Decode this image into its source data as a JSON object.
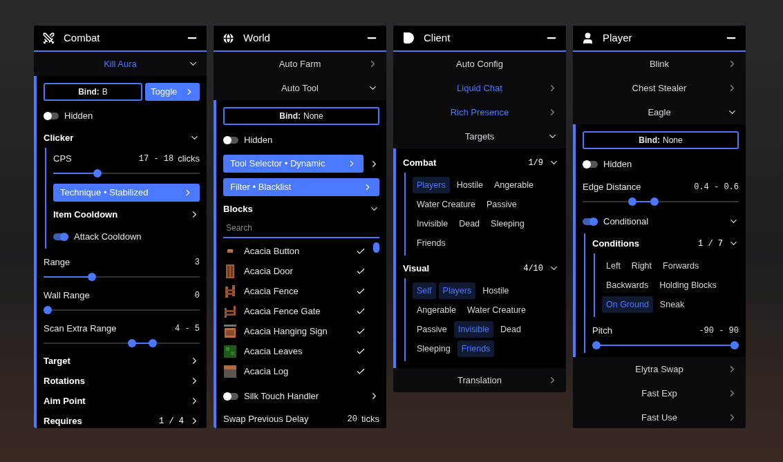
{
  "panels": [
    {
      "title": "Combat",
      "items": [
        {
          "kind": "module",
          "name": "Kill Aura",
          "enabled": true,
          "has_settings": true,
          "expanded": true,
          "children": [
            {
              "kind": "bind",
              "label": "Bind:",
              "value": "B",
              "mode": "Toggle"
            },
            {
              "kind": "toggle",
              "label": "Hidden",
              "on": false
            },
            {
              "kind": "group",
              "label": "Clicker",
              "expanded": true,
              "children": [
                {
                  "kind": "slider",
                  "label": "CPS",
                  "value": "17 - 18",
                  "unit": "clicks",
                  "thumbs": [
                    {
                      "level": 0.29
                    }
                  ]
                },
                {
                  "kind": "choice",
                  "label": "Technique • Stabilized",
                  "outer_arrow": false
                },
                {
                  "kind": "group",
                  "label": "Item Cooldown",
                  "expanded": false
                },
                {
                  "kind": "toggle",
                  "label": "Attack Cooldown",
                  "on": true
                }
              ]
            },
            {
              "kind": "slider",
              "label": "Range",
              "value": "3",
              "thumbs": [
                {
                  "level": 0.3
                }
              ]
            },
            {
              "kind": "slider",
              "label": "Wall Range",
              "value": "0",
              "thumbs": [
                {
                  "level": 0
                }
              ]
            },
            {
              "kind": "slider",
              "label": "Scan Extra Range",
              "value": "4 - 5",
              "thumbs": [
                {
                  "level": 0.57
                },
                {
                  "level": 0.71
                }
              ]
            },
            {
              "kind": "group",
              "label": "Target",
              "expanded": false
            },
            {
              "kind": "group",
              "label": "Rotations",
              "expanded": false
            },
            {
              "kind": "group",
              "label": "Aim Point",
              "expanded": false
            },
            {
              "kind": "group",
              "label": "Requires",
              "count": "1 / 4",
              "expanded": false
            }
          ]
        }
      ]
    },
    {
      "title": "World",
      "items": [
        {
          "kind": "module",
          "name": "Auto Farm",
          "enabled": false,
          "has_settings": true,
          "expanded": false
        },
        {
          "kind": "module",
          "name": "Auto Tool",
          "enabled": false,
          "has_settings": true,
          "expanded": true,
          "children": [
            {
              "kind": "bind",
              "label": "Bind:",
              "value": "None"
            },
            {
              "kind": "toggle",
              "label": "Hidden",
              "on": false
            },
            {
              "kind": "choice",
              "label": "Tool Selector • Dynamic",
              "outer_arrow": true
            },
            {
              "kind": "choice",
              "label": "Filter • Blacklist",
              "outer_arrow": false
            },
            {
              "kind": "group",
              "label": "Blocks",
              "expanded": true,
              "children": [
                {
                  "kind": "search",
                  "placeholder": "Search"
                },
                {
                  "kind": "blocks",
                  "items": [
                    {
                      "name": "Acacia Button",
                      "checked": true
                    },
                    {
                      "name": "Acacia Door",
                      "checked": true
                    },
                    {
                      "name": "Acacia Fence",
                      "checked": true
                    },
                    {
                      "name": "Acacia Fence Gate",
                      "checked": true
                    },
                    {
                      "name": "Acacia Hanging Sign",
                      "checked": true
                    },
                    {
                      "name": "Acacia Leaves",
                      "checked": true
                    },
                    {
                      "name": "Acacia Log",
                      "checked": true
                    }
                  ]
                }
              ]
            },
            {
              "kind": "toggle",
              "label": "Silk Touch Handler",
              "on": false,
              "expanded": false
            },
            {
              "kind": "slider",
              "label": "Swap Previous Delay",
              "value": "20",
              "unit": "ticks"
            }
          ]
        }
      ]
    },
    {
      "title": "Client",
      "items": [
        {
          "kind": "module",
          "name": "Auto Config",
          "enabled": false,
          "has_settings": false
        },
        {
          "kind": "module",
          "name": "Liquid Chat",
          "enabled": true,
          "has_settings": true,
          "expanded": false
        },
        {
          "kind": "module",
          "name": "Rich Presence",
          "enabled": true,
          "has_settings": true,
          "expanded": false
        },
        {
          "kind": "module",
          "name": "Targets",
          "enabled": false,
          "has_settings": true,
          "expanded": true,
          "children": [
            {
              "kind": "group",
              "label": "Combat",
              "count": "1/9",
              "expanded": true,
              "children": [
                {
                  "kind": "tags",
                  "items": [
                    {
                      "label": "Players",
                      "selected": true
                    },
                    {
                      "label": "Hostile",
                      "selected": false
                    },
                    {
                      "label": "Angerable",
                      "selected": false
                    },
                    {
                      "label": "Water Creature",
                      "selected": false
                    },
                    {
                      "label": "Passive",
                      "selected": false
                    },
                    {
                      "label": "Invisible",
                      "selected": false
                    },
                    {
                      "label": "Dead",
                      "selected": false
                    },
                    {
                      "label": "Sleeping",
                      "selected": false
                    },
                    {
                      "label": "Friends",
                      "selected": false
                    }
                  ]
                }
              ]
            },
            {
              "kind": "group",
              "label": "Visual",
              "count": "4/10",
              "expanded": true,
              "children": [
                {
                  "kind": "tags",
                  "items": [
                    {
                      "label": "Self",
                      "selected": true
                    },
                    {
                      "label": "Players",
                      "selected": true
                    },
                    {
                      "label": "Hostile",
                      "selected": false
                    },
                    {
                      "label": "Angerable",
                      "selected": false
                    },
                    {
                      "label": "Water Creature",
                      "selected": false
                    },
                    {
                      "label": "Passive",
                      "selected": false
                    },
                    {
                      "label": "Invisible",
                      "selected": true
                    },
                    {
                      "label": "Dead",
                      "selected": false
                    },
                    {
                      "label": "Sleeping",
                      "selected": false
                    },
                    {
                      "label": "Friends",
                      "selected": true
                    }
                  ]
                }
              ]
            }
          ]
        },
        {
          "kind": "module",
          "name": "Translation",
          "enabled": false,
          "has_settings": true,
          "expanded": false
        }
      ]
    },
    {
      "title": "Player",
      "items": [
        {
          "kind": "module",
          "name": "Blink",
          "enabled": false,
          "has_settings": true,
          "expanded": false
        },
        {
          "kind": "module",
          "name": "Chest Stealer",
          "enabled": false,
          "has_settings": true,
          "expanded": false
        },
        {
          "kind": "module",
          "name": "Eagle",
          "enabled": false,
          "has_settings": true,
          "expanded": true,
          "children": [
            {
              "kind": "bind",
              "label": "Bind:",
              "value": "None"
            },
            {
              "kind": "toggle",
              "label": "Hidden",
              "on": false
            },
            {
              "kind": "slider",
              "label": "Edge Distance",
              "value": "0.4 - 0.6",
              "thumbs": [
                {
                  "level": 0.31
                },
                {
                  "level": 0.46
                }
              ]
            },
            {
              "kind": "toggle",
              "label": "Conditional",
              "on": true,
              "expanded": true,
              "children": [
                {
                  "kind": "group",
                  "label": "Conditions",
                  "count": "1 / 7",
                  "expanded": true,
                  "children": [
                    {
                      "kind": "tags",
                      "items": [
                        {
                          "label": "Left",
                          "selected": false
                        },
                        {
                          "label": "Right",
                          "selected": false
                        },
                        {
                          "label": "Forwards",
                          "selected": false
                        },
                        {
                          "label": "Backwards",
                          "selected": false
                        },
                        {
                          "label": "Holding Blocks",
                          "selected": false
                        },
                        {
                          "label": "On Ground",
                          "selected": true
                        },
                        {
                          "label": "Sneak",
                          "selected": false
                        }
                      ]
                    }
                  ]
                },
                {
                  "kind": "slider",
                  "label": "Pitch",
                  "value": "-90 - 90",
                  "thumbs": [
                    {
                      "level": 0
                    },
                    {
                      "level": 1
                    }
                  ]
                }
              ]
            }
          ]
        },
        {
          "kind": "module",
          "name": "Elytra Swap",
          "enabled": false,
          "has_settings": true,
          "expanded": false
        },
        {
          "kind": "module",
          "name": "Fast Exp",
          "enabled": false,
          "has_settings": true,
          "expanded": false
        },
        {
          "kind": "module",
          "name": "Fast Use",
          "enabled": false,
          "has_settings": true,
          "expanded": false
        }
      ]
    }
  ]
}
